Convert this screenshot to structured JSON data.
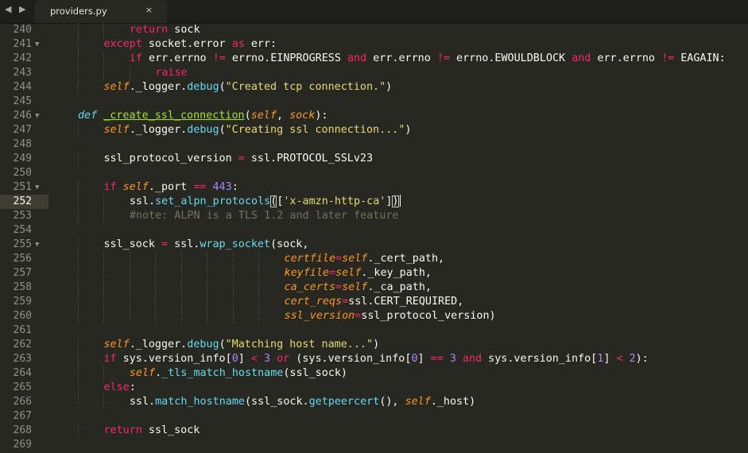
{
  "window": {
    "nav_arrows": "◀ ▶",
    "tab": {
      "title": "providers.py",
      "close_glyph": "×"
    }
  },
  "theme": {
    "background": "#272822",
    "keyword": "#f92672",
    "string": "#e6db74",
    "number": "#ae81ff",
    "function": "#66d9ef",
    "parameter": "#fd971f",
    "comment": "#75715e",
    "definition": "#a6e22e"
  },
  "editor": {
    "active_line": 252,
    "lines": [
      {
        "num": "240",
        "fold": "",
        "indent": 2,
        "tokens": [
          [
            "kw",
            "return"
          ],
          [
            "",
            " sock"
          ]
        ]
      },
      {
        "num": "241",
        "fold": "▼",
        "indent": 1,
        "tokens": [
          [
            "kw",
            "except"
          ],
          [
            "",
            " socket.error "
          ],
          [
            "kw",
            "as"
          ],
          [
            "",
            " err:"
          ]
        ]
      },
      {
        "num": "242",
        "fold": "",
        "indent": 2,
        "tokens": [
          [
            "kw",
            "if"
          ],
          [
            "",
            " err.errno "
          ],
          [
            "kw",
            "!="
          ],
          [
            "",
            " errno.EINPROGRESS "
          ],
          [
            "kw",
            "and"
          ],
          [
            "",
            " err.errno "
          ],
          [
            "kw",
            "!="
          ],
          [
            "",
            " errno.EWOULDBLOCK "
          ],
          [
            "kw",
            "and"
          ],
          [
            "",
            " err.errno "
          ],
          [
            "kw",
            "!="
          ],
          [
            "",
            " EAGAIN:"
          ]
        ]
      },
      {
        "num": "243",
        "fold": "",
        "indent": 3,
        "tokens": [
          [
            "kw",
            "raise"
          ]
        ]
      },
      {
        "num": "244",
        "fold": "",
        "indent": 1,
        "tokens": [
          [
            "it",
            "self"
          ],
          [
            "",
            "._logger."
          ],
          [
            "fn",
            "debug"
          ],
          [
            "",
            "("
          ],
          [
            "st",
            "\"Created tcp connection.\""
          ],
          [
            "",
            ")"
          ]
        ]
      },
      {
        "num": "245",
        "fold": "",
        "indent": 0,
        "tokens": []
      },
      {
        "num": "246",
        "fold": "▼",
        "indent": 0,
        "tokens": [
          [
            "de",
            "def"
          ],
          [
            "",
            " "
          ],
          [
            "df",
            "_create_ssl_connection"
          ],
          [
            "",
            "("
          ],
          [
            "it",
            "self"
          ],
          [
            "",
            ", "
          ],
          [
            "it",
            "sock"
          ],
          [
            "",
            "):"
          ]
        ]
      },
      {
        "num": "247",
        "fold": "",
        "indent": 1,
        "tokens": [
          [
            "it",
            "self"
          ],
          [
            "",
            "._logger."
          ],
          [
            "fn",
            "debug"
          ],
          [
            "",
            "("
          ],
          [
            "st",
            "\"Creating ssl connection...\""
          ],
          [
            "",
            ")"
          ]
        ]
      },
      {
        "num": "248",
        "fold": "",
        "indent": 0,
        "tokens": []
      },
      {
        "num": "249",
        "fold": "",
        "indent": 1,
        "tokens": [
          [
            "",
            "ssl_protocol_version "
          ],
          [
            "kw",
            "="
          ],
          [
            "",
            " ssl.PROTOCOL_SSLv23"
          ]
        ]
      },
      {
        "num": "250",
        "fold": "",
        "indent": 0,
        "tokens": []
      },
      {
        "num": "251",
        "fold": "▼",
        "indent": 1,
        "tokens": [
          [
            "kw",
            "if"
          ],
          [
            "",
            " "
          ],
          [
            "it",
            "self"
          ],
          [
            "",
            "._port "
          ],
          [
            "kw",
            "=="
          ],
          [
            "",
            " "
          ],
          [
            "nm",
            "443"
          ],
          [
            "",
            ":"
          ]
        ]
      },
      {
        "num": "252",
        "fold": "",
        "indent": 2,
        "tokens": [
          [
            "",
            "ssl."
          ],
          [
            "fn",
            "set_alpn_protocols"
          ],
          [
            "bm",
            "("
          ],
          [
            "",
            "["
          ],
          [
            "st",
            "'x-amzn-http-ca'"
          ],
          [
            "",
            "]"
          ],
          [
            "bm",
            ")"
          ],
          [
            "caret",
            ""
          ]
        ]
      },
      {
        "num": "253",
        "fold": "",
        "indent": 2,
        "tokens": [
          [
            "cm",
            "#note: ALPN is a TLS 1.2 and later feature"
          ]
        ]
      },
      {
        "num": "254",
        "fold": "",
        "indent": 0,
        "tokens": []
      },
      {
        "num": "255",
        "fold": "▼",
        "indent": 1,
        "tokens": [
          [
            "",
            "ssl_sock "
          ],
          [
            "kw",
            "="
          ],
          [
            "",
            " ssl."
          ],
          [
            "fn",
            "wrap_socket"
          ],
          [
            "",
            "(sock,"
          ]
        ]
      },
      {
        "num": "256",
        "fold": "",
        "indent": 8,
        "tokens": [
          [
            "it",
            "certfile"
          ],
          [
            "kw",
            "="
          ],
          [
            "it",
            "self"
          ],
          [
            "",
            "._cert_path,"
          ]
        ]
      },
      {
        "num": "257",
        "fold": "",
        "indent": 8,
        "tokens": [
          [
            "it",
            "keyfile"
          ],
          [
            "kw",
            "="
          ],
          [
            "it",
            "self"
          ],
          [
            "",
            "._key_path,"
          ]
        ]
      },
      {
        "num": "258",
        "fold": "",
        "indent": 8,
        "tokens": [
          [
            "it",
            "ca_certs"
          ],
          [
            "kw",
            "="
          ],
          [
            "it",
            "self"
          ],
          [
            "",
            "._ca_path,"
          ]
        ]
      },
      {
        "num": "259",
        "fold": "",
        "indent": 8,
        "tokens": [
          [
            "it",
            "cert_reqs"
          ],
          [
            "kw",
            "="
          ],
          [
            "",
            "ssl.CERT_REQUIRED,"
          ]
        ]
      },
      {
        "num": "260",
        "fold": "",
        "indent": 8,
        "tokens": [
          [
            "it",
            "ssl_version"
          ],
          [
            "kw",
            "="
          ],
          [
            "",
            "ssl_protocol_version)"
          ]
        ]
      },
      {
        "num": "261",
        "fold": "",
        "indent": 0,
        "tokens": []
      },
      {
        "num": "262",
        "fold": "",
        "indent": 1,
        "tokens": [
          [
            "it",
            "self"
          ],
          [
            "",
            "._logger."
          ],
          [
            "fn",
            "debug"
          ],
          [
            "",
            "("
          ],
          [
            "st",
            "\"Matching host name...\""
          ],
          [
            "",
            ")"
          ]
        ]
      },
      {
        "num": "263",
        "fold": "",
        "indent": 1,
        "tokens": [
          [
            "kw",
            "if"
          ],
          [
            "",
            " sys.version_info["
          ],
          [
            "nm",
            "0"
          ],
          [
            "",
            "] "
          ],
          [
            "kw",
            "<"
          ],
          [
            "",
            " "
          ],
          [
            "nm",
            "3"
          ],
          [
            "",
            " "
          ],
          [
            "kw",
            "or"
          ],
          [
            "",
            " (sys.version_info["
          ],
          [
            "nm",
            "0"
          ],
          [
            "",
            "] "
          ],
          [
            "kw",
            "=="
          ],
          [
            "",
            " "
          ],
          [
            "nm",
            "3"
          ],
          [
            "",
            " "
          ],
          [
            "kw",
            "and"
          ],
          [
            "",
            " sys.version_info["
          ],
          [
            "nm",
            "1"
          ],
          [
            "",
            "] "
          ],
          [
            "kw",
            "<"
          ],
          [
            "",
            " "
          ],
          [
            "nm",
            "2"
          ],
          [
            "",
            "):"
          ]
        ]
      },
      {
        "num": "264",
        "fold": "",
        "indent": 2,
        "tokens": [
          [
            "it",
            "self"
          ],
          [
            "",
            "."
          ],
          [
            "fn",
            "_tls_match_hostname"
          ],
          [
            "",
            "(ssl_sock)"
          ]
        ]
      },
      {
        "num": "265",
        "fold": "",
        "indent": 1,
        "tokens": [
          [
            "kw",
            "else"
          ],
          [
            "",
            ":"
          ]
        ]
      },
      {
        "num": "266",
        "fold": "",
        "indent": 2,
        "tokens": [
          [
            "",
            "ssl."
          ],
          [
            "fn",
            "match_hostname"
          ],
          [
            "",
            "(ssl_sock."
          ],
          [
            "fn",
            "getpeercert"
          ],
          [
            "",
            "(), "
          ],
          [
            "it",
            "self"
          ],
          [
            "",
            "._host)"
          ]
        ]
      },
      {
        "num": "267",
        "fold": "",
        "indent": 0,
        "tokens": []
      },
      {
        "num": "268",
        "fold": "",
        "indent": 1,
        "tokens": [
          [
            "kw",
            "return"
          ],
          [
            "",
            " ssl_sock"
          ]
        ]
      },
      {
        "num": "269",
        "fold": "",
        "indent": 0,
        "tokens": []
      }
    ]
  }
}
